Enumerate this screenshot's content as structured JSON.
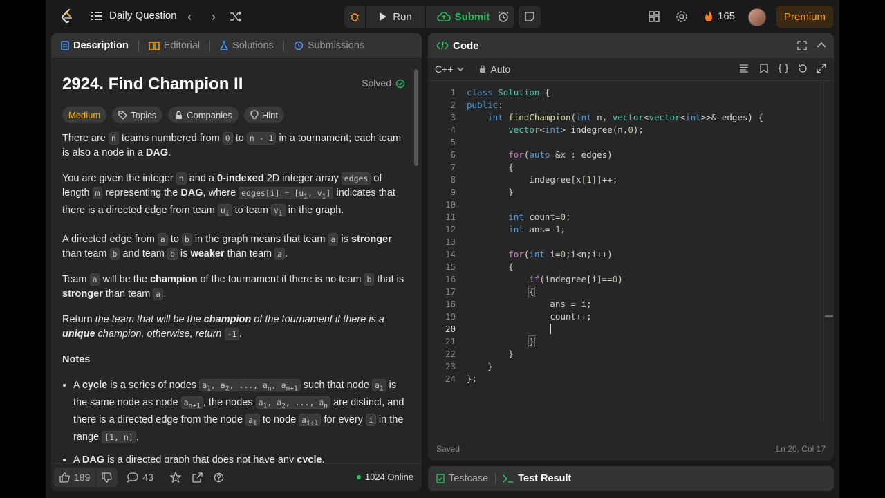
{
  "topbar": {
    "problem_list_label": "Daily Question",
    "run_label": "Run",
    "submit_label": "Submit",
    "streak_count": "165",
    "premium_label": "Premium"
  },
  "left": {
    "tabs": [
      "Description",
      "Editorial",
      "Solutions",
      "Submissions"
    ],
    "title": "2924. Find Champion II",
    "status": "Solved",
    "tags": [
      "Medium",
      "Topics",
      "Companies",
      "Hint"
    ],
    "likes": "189",
    "comments": "43",
    "online": "1024 Online"
  },
  "right": {
    "panel_title": "Code",
    "language": "C++",
    "mode": "Auto",
    "save_status": "Saved",
    "cursor_pos": "Ln 20, Col 17",
    "test_tabs": [
      "Testcase",
      "Test Result"
    ]
  },
  "colors": {
    "accent": "#ffa116",
    "success": "#2cbb5d",
    "medium": "#ffb800"
  }
}
